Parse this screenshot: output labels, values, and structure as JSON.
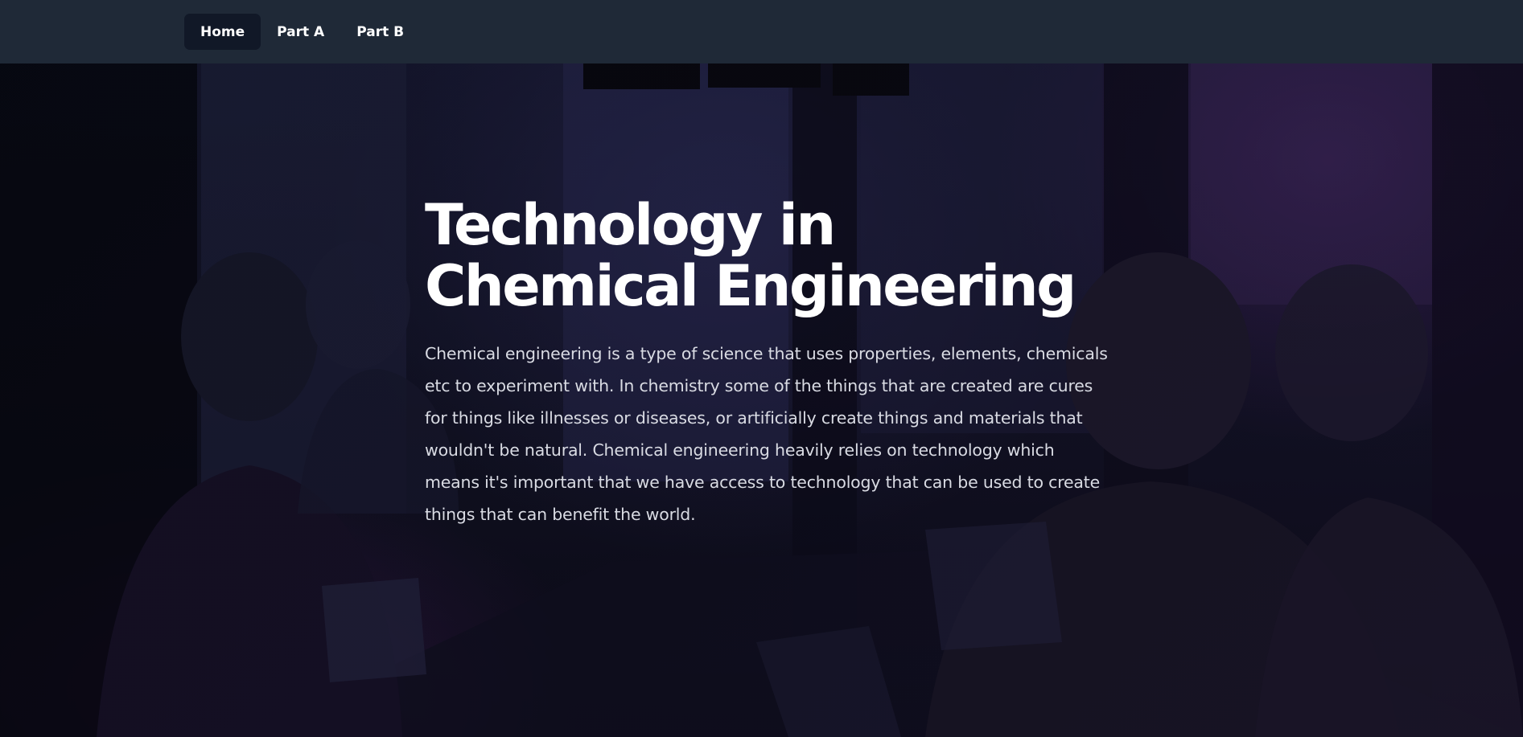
{
  "nav": {
    "items": [
      {
        "label": "Home",
        "active": true
      },
      {
        "label": "Part A",
        "active": false
      },
      {
        "label": "Part B",
        "active": false
      }
    ]
  },
  "hero": {
    "title": "Technology in Chemical Engineering",
    "body": "Chemical engineering is a type of science that uses properties, elements, chemicals etc to experiment with. In chemistry some of the things that are created are cures for things like illnesses or diseases, or artificially create things and materials that wouldn't be natural. Chemical engineering heavily relies on technology which means it's important that we have access to technology that can be used to create things that can benefit the world."
  },
  "colors": {
    "navbar_bg": "#1f2937",
    "active_nav_bg": "#111827",
    "text_primary": "#ffffff",
    "text_body": "#d9dbe3"
  }
}
